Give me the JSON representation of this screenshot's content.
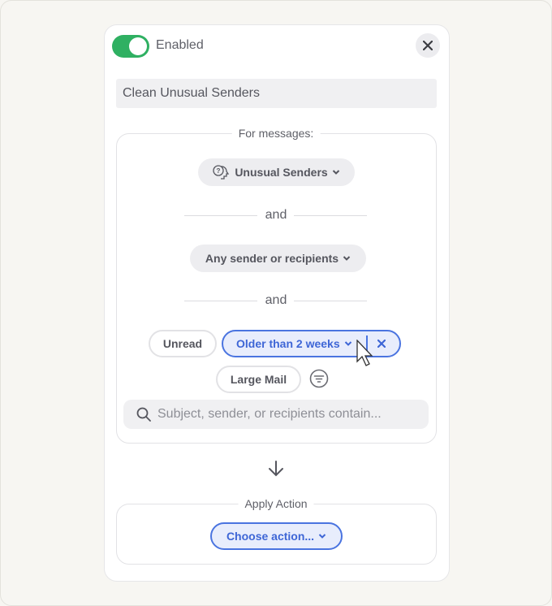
{
  "header": {
    "enabled_label": "Enabled",
    "enabled": true,
    "close_icon": "close-icon"
  },
  "rule_name": "Clean Unusual Senders",
  "conditions": {
    "legend": "For messages:",
    "sender_type": "Unusual Senders",
    "connector1": "and",
    "participants": "Any sender or recipients",
    "connector2": "and",
    "chips": [
      {
        "label": "Unread",
        "active": false
      },
      {
        "label": "Older than 2 weeks",
        "active": true
      },
      {
        "label": "Large Mail",
        "active": false
      }
    ],
    "search_placeholder": "Subject, sender, or recipients contain..."
  },
  "action": {
    "legend": "Apply Action",
    "choose_label": "Choose action..."
  },
  "colors": {
    "toggle": "#2fb062",
    "accent": "#4a74e0"
  }
}
